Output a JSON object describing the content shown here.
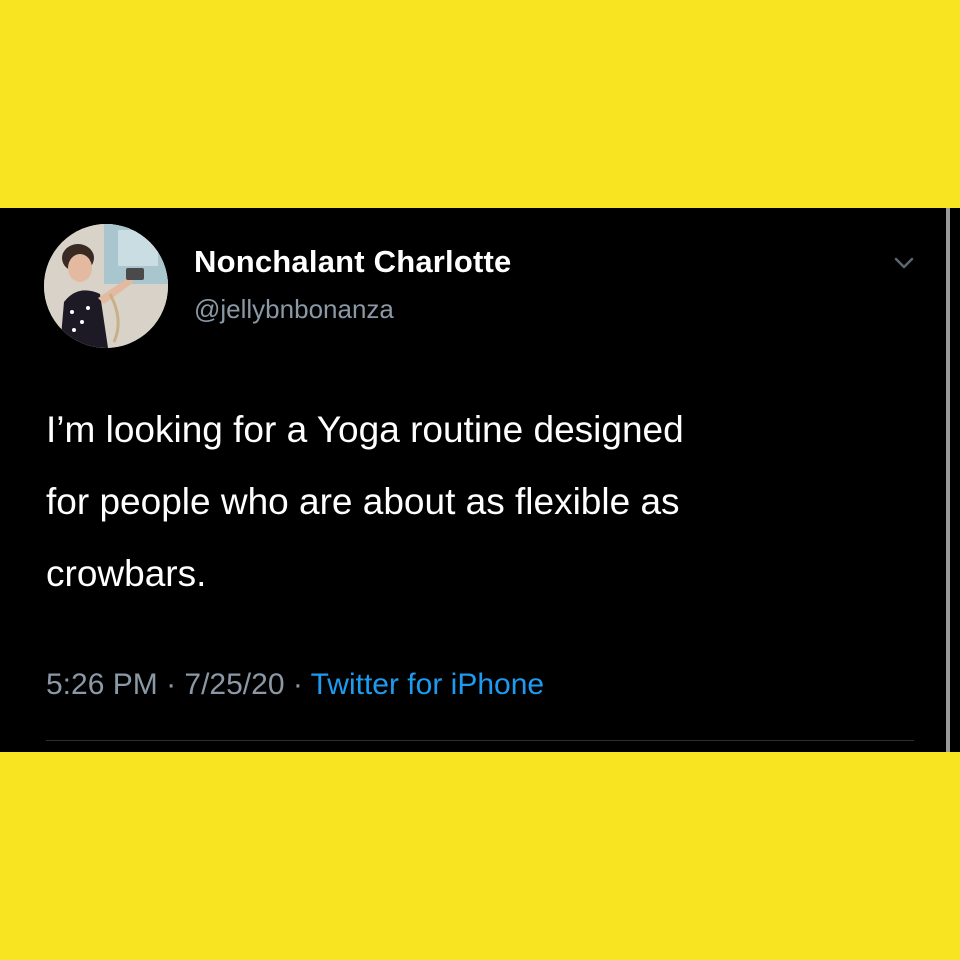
{
  "tweet": {
    "display_name": "Nonchalant Charlotte",
    "handle": "@jellybnbonanza",
    "text_lines": [
      "I’m looking for a Yoga routine designed",
      "for people who are about as flexible as",
      "crowbars."
    ],
    "time": "5:26 PM",
    "separator": " · ",
    "date": "7/25/20",
    "source": "Twitter for iPhone"
  },
  "icons": {
    "menu": "chevron-down-icon",
    "avatar": "profile-avatar"
  },
  "colors": {
    "frame_background": "#f8e421",
    "tweet_background": "#000000",
    "text_primary": "#ffffff",
    "text_secondary": "#8b98a5",
    "link": "#1d9bf0"
  }
}
